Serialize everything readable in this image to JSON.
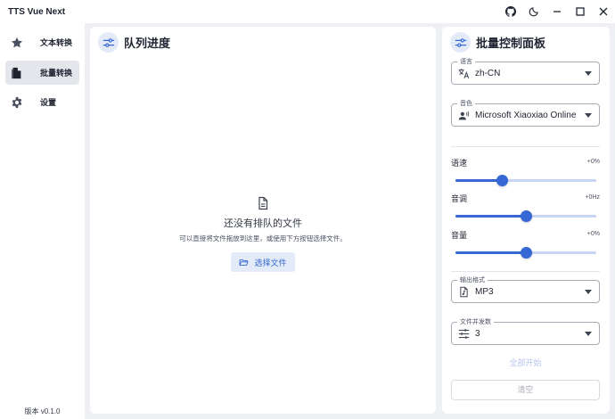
{
  "window": {
    "title": "TTS Vue Next"
  },
  "sidebar": {
    "items": [
      {
        "label": "文本转换",
        "icon": "star-icon"
      },
      {
        "label": "批量转换",
        "icon": "file-icon",
        "active": true
      },
      {
        "label": "设置",
        "icon": "gear-icon"
      }
    ],
    "version": "版本 v0.1.0"
  },
  "queue": {
    "title": "队列进度",
    "empty_title": "还没有排队的文件",
    "empty_subtitle": "可以直接将文件拖放到这里，或使用下方按钮选择文件。",
    "pick_button": "选择文件"
  },
  "control": {
    "title": "批量控制面板",
    "language": {
      "label": "语言",
      "value": "zh-CN"
    },
    "voice": {
      "label": "音色",
      "value": "Microsoft Xiaoxiao Online"
    },
    "speed": {
      "label": "语速",
      "value": "+0%",
      "level": 0.33
    },
    "pitch": {
      "label": "音调",
      "value": "+0Hz",
      "level": 0.5
    },
    "volume": {
      "label": "音量",
      "value": "+0%",
      "level": 0.5
    },
    "format": {
      "label": "输出格式",
      "value": "MP3"
    },
    "concurrency": {
      "label": "文件并发数",
      "value": "3"
    },
    "start_button": "全部开始",
    "clear_button": "清空"
  },
  "colors": {
    "accent": "#3568d4",
    "accent_light": "#c9d6f3",
    "background": "#eef0f4"
  }
}
